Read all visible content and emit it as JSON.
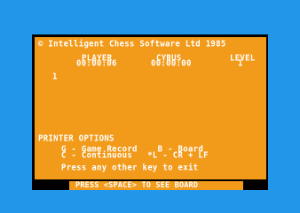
{
  "header": {
    "copyright": "© Intelligent Chess Software Ltd 1985"
  },
  "status": {
    "player_label": "PLAYER",
    "player_time": "00:00:06",
    "cyrus_label": "CYRUS",
    "cyrus_time": "00:00:00",
    "level_label": "LEVEL",
    "level_value": "1"
  },
  "moves": {
    "move_number": "1"
  },
  "printer_options": {
    "title": "PRINTER OPTIONS",
    "line1": "G - Game Record    B - Board",
    "line2": "C - Continuous   *L - CR + LF",
    "exit_prompt": "Press any other key to exit"
  },
  "footer": {
    "prompt": "PRESS <SPACE> TO SEE BOARD"
  },
  "colors": {
    "background": "#2296e8",
    "paper": "#f29a1a",
    "border": "#000000",
    "text": "#ffffff"
  }
}
